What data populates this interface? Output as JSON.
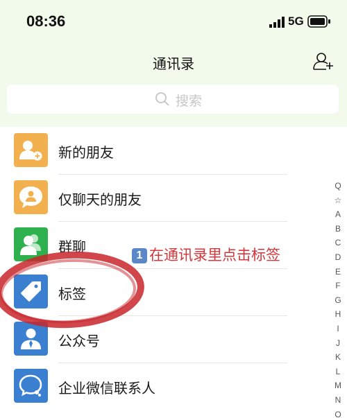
{
  "status_bar": {
    "time": "08:36",
    "network": "5G"
  },
  "header": {
    "title": "通讯录",
    "add_friend_icon": "person-plus-icon"
  },
  "search": {
    "placeholder": "搜索",
    "icon": "search-icon"
  },
  "items": [
    {
      "label": "新的朋友",
      "icon": "person-add-icon",
      "color": "#f2b14e"
    },
    {
      "label": "仅聊天的朋友",
      "icon": "chat-bubble-icon",
      "color": "#f2b14e"
    },
    {
      "label": "群聊",
      "icon": "group-icon",
      "color": "#2fb04f"
    },
    {
      "label": "标签",
      "icon": "tag-icon",
      "color": "#3a7fd0"
    },
    {
      "label": "公众号",
      "icon": "official-account-icon",
      "color": "#3a7fd0"
    },
    {
      "label": "企业微信联系人",
      "icon": "work-chat-icon",
      "color": "#3a7fd0"
    }
  ],
  "index_bar": [
    "Q",
    "☆",
    "A",
    "B",
    "C",
    "D",
    "E",
    "F",
    "G",
    "H",
    "I",
    "J",
    "K",
    "L",
    "M",
    "N",
    "O"
  ],
  "annotation": {
    "badge": "1",
    "text": "在通讯录里点击标签",
    "color": "#d2373c"
  },
  "colors": {
    "header_bg": "#f2faec",
    "highlight_ring": "#c8262c"
  }
}
